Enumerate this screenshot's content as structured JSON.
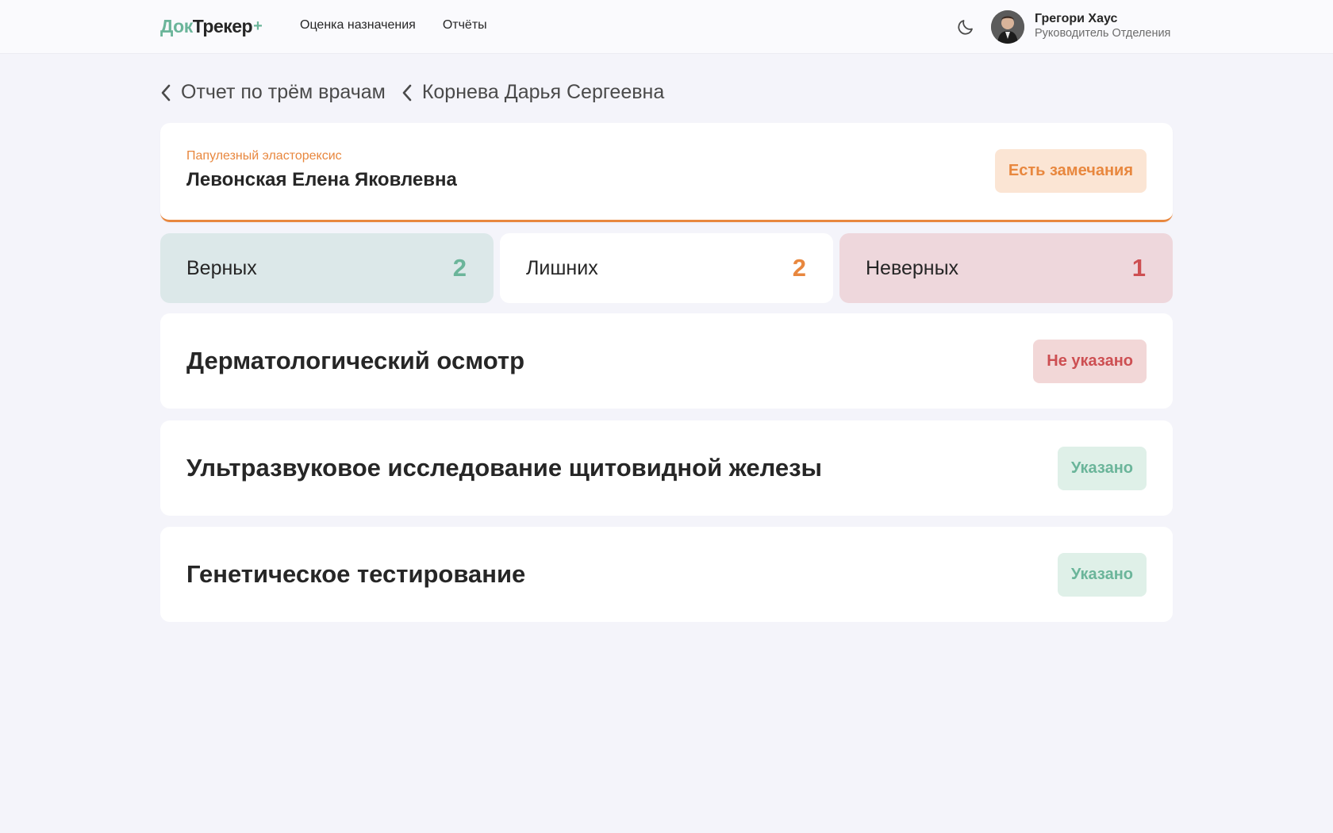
{
  "header": {
    "logo_part1": "Док",
    "logo_part2": "Трекер",
    "logo_plus": "+",
    "nav": [
      {
        "label": "Оценка назначения"
      },
      {
        "label": "Отчёты"
      }
    ],
    "theme_toggle_icon": "moon-icon",
    "user": {
      "name": "Грегори Хаус",
      "role": "Руководитель Отделения"
    }
  },
  "breadcrumb": [
    {
      "label": "Отчет по трём врачам",
      "icon": "chevron-left-icon"
    },
    {
      "label": "Корнева Дарья Сергеевна",
      "icon": "chevron-left-icon"
    }
  ],
  "patient": {
    "diagnosis": "Папулезный эласторексис",
    "name": "Левонская Елена Яковлевна",
    "status": "Есть замечания"
  },
  "stats": {
    "correct": {
      "label": "Верных",
      "count": "2"
    },
    "extra": {
      "label": "Лишних",
      "count": "2"
    },
    "wrong": {
      "label": "Неверных",
      "count": "1"
    }
  },
  "items": [
    {
      "title": "Дерматологический осмотр",
      "status": "Не указано"
    },
    {
      "title": "Ультразвуковое исследование щитовидной железы",
      "status": "Указано"
    },
    {
      "title": "Генетическое тестирование",
      "status": "Указано"
    }
  ],
  "colors": {
    "accent_green": "#6bb59a",
    "accent_orange": "#e8873e",
    "accent_red": "#cd4f52",
    "background": "#f4f4fa"
  }
}
